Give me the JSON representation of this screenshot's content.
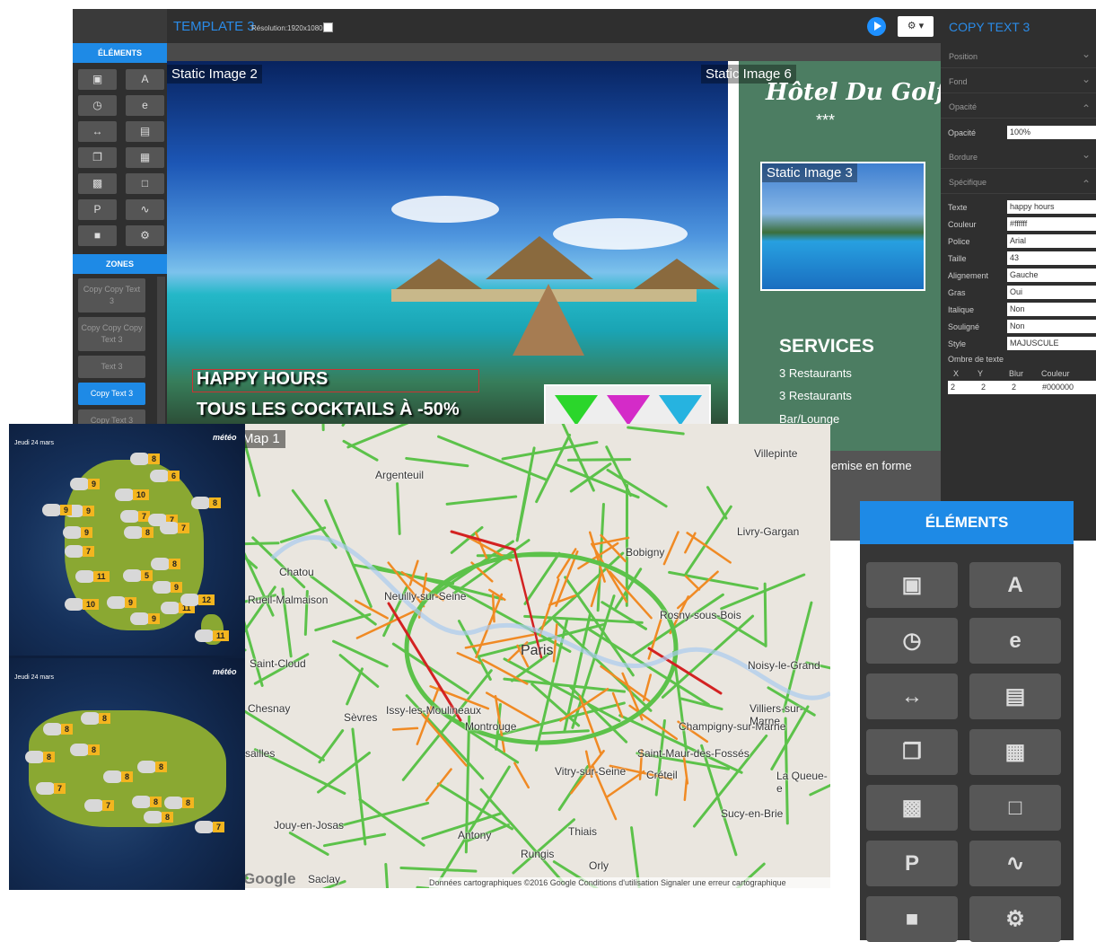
{
  "editor": {
    "template_title": "TEMPLATE 3",
    "resolution": "Résolution:1920x1080",
    "left_panel": {
      "elements_header": "ÉLÉMENTS",
      "elements_icons": [
        "zone-icon",
        "text-icon",
        "clock-icon",
        "ie-icon",
        "arrows-icon",
        "image-icon",
        "copy-icon",
        "film-icon",
        "qr-icon",
        "pdf-icon",
        "ppt-icon",
        "rss-icon",
        "car-icon",
        "gear-icon"
      ],
      "zones_header": "ZONES",
      "zones": [
        "Copy Copy Text 3",
        "Copy Copy Copy Text 3",
        "Text 3",
        "Copy Text 3",
        "Copy Text 3"
      ]
    },
    "canvas": {
      "static_image_2": "Static Image 2",
      "static_image_6": "Static Image 6",
      "static_image_3": "Static Image 3",
      "happy_hours": "HAPPY HOURS",
      "cocktails": "TOUS LES COCKTAILS À -50%",
      "hotel_name": "Hôtel Du Golf",
      "stars": "***",
      "services_title": "SERVICES",
      "services": [
        "3 Restaurants",
        "3 Restaurants",
        "Bar/Lounge",
        "emise en forme"
      ]
    },
    "right_panel": {
      "title": "COPY TEXT 3",
      "sections": [
        "Position",
        "Fond",
        "Opacité",
        "Bordure",
        "Spécifique"
      ],
      "opacity_label": "Opacité",
      "opacity_value": "100%",
      "props": [
        {
          "label": "Texte",
          "value": "happy hours"
        },
        {
          "label": "Couleur",
          "value": "#ffffff"
        },
        {
          "label": "Police",
          "value": "Arial"
        },
        {
          "label": "Taille",
          "value": "43"
        },
        {
          "label": "Alignement",
          "value": "Gauche"
        },
        {
          "label": "Gras",
          "value": "Oui"
        },
        {
          "label": "Italique",
          "value": "Non"
        },
        {
          "label": "Souligné",
          "value": "Non"
        },
        {
          "label": "Style",
          "value": "MAJUSCULE"
        }
      ],
      "shadow_label": "Ombre de texte",
      "shadow_cols": [
        "X",
        "Y",
        "Blur",
        "Couleur"
      ],
      "shadow_values": [
        "2",
        "2",
        "2",
        "#000000"
      ]
    }
  },
  "weather": {
    "date_top": "Jeudi 24 mars",
    "date_bottom": "Jeudi 24 mars",
    "logo": "météo",
    "temps_top": [
      "8",
      "6",
      "9",
      "8",
      "10",
      "9",
      "9",
      "7",
      "7",
      "7",
      "8",
      "9",
      "7",
      "8",
      "11",
      "5",
      "9",
      "10",
      "9",
      "11",
      "12",
      "9",
      "11"
    ],
    "temps_bottom": [
      "8",
      "8",
      "8",
      "8",
      "8",
      "8",
      "7",
      "7",
      "8",
      "8",
      "8",
      "7"
    ]
  },
  "map": {
    "label": "Map 1",
    "center": "Paris",
    "places": [
      "Argenteuil",
      "Villepinte",
      "Livry-Gargan",
      "Bobigny",
      "Chatou",
      "Rueil-Malmaison",
      "Neuilly-sur-Seine",
      "Rosny-sous-Bois",
      "Saint-Cloud",
      "Noisy-le-Grand",
      "Chesnay",
      "Sèvres",
      "Issy-les-Moulineaux",
      "Montrouge",
      "Villiers-sur-Marne",
      "Champigny-sur-Marne",
      "Saint-Maur-des-Fossés",
      "Vitry-sur-Seine",
      "Créteil",
      "sailles",
      "Jouy-en-Josas",
      "Antony",
      "Thiais",
      "Rungis",
      "Orly",
      "Sucy-en-Brie",
      "La Queue-e",
      "Saclay"
    ],
    "footer": "Données cartographiques ©2016 Google   Conditions d'utilisation   Signaler une erreur cartographique",
    "google": "Google"
  },
  "elements_panel": {
    "header": "ÉLÉMENTS"
  },
  "colors": {
    "accent": "#1e8ae6",
    "hotel_green": "#4c7d62",
    "traffic_green": "#5cc24a",
    "traffic_orange": "#f08a24",
    "traffic_red": "#d32222"
  }
}
